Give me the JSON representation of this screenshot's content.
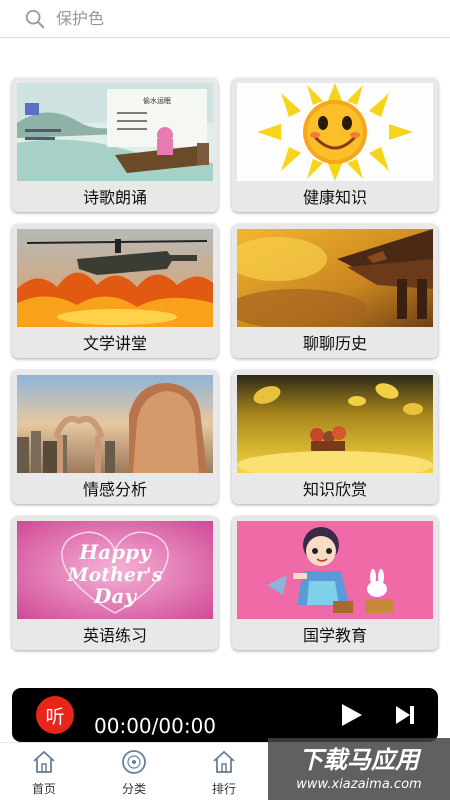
{
  "search": {
    "placeholder": "保护色"
  },
  "categories": [
    {
      "label": "诗歌朗诵"
    },
    {
      "label": "健康知识"
    },
    {
      "label": "文学讲堂"
    },
    {
      "label": "聊聊历史"
    },
    {
      "label": "情感分析"
    },
    {
      "label": "知识欣赏"
    },
    {
      "label": "英语练习"
    },
    {
      "label": "国学教育"
    }
  ],
  "thumbnails": {
    "poem_title": "偷水运眠",
    "mothers_day": [
      "Happy",
      "Mother's",
      "Day"
    ]
  },
  "player": {
    "logo": "听",
    "time": "00:00/00:00"
  },
  "nav": {
    "items": [
      {
        "label": "首页",
        "icon": "home-icon"
      },
      {
        "label": "分类",
        "icon": "disc-icon"
      },
      {
        "label": "排行",
        "icon": "home-icon"
      }
    ]
  },
  "watermark": {
    "text": "下载马应用",
    "url": "www.xiazaima.com"
  },
  "colors": {
    "accent": "#e8251a",
    "player_bg": "#000000"
  }
}
